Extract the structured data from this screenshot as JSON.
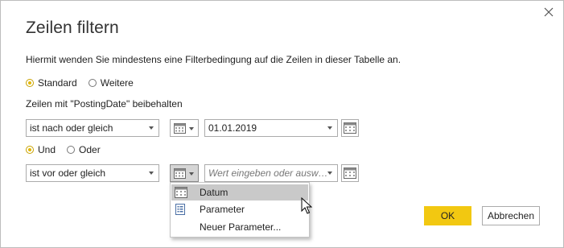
{
  "dialog": {
    "title": "Zeilen filtern",
    "description": "Hiermit wenden Sie mindestens eine Filterbedingung auf die Zeilen in dieser Tabelle an.",
    "mode_options": [
      {
        "label": "Standard",
        "selected": true
      },
      {
        "label": "Weitere",
        "selected": false
      }
    ],
    "keep_label": "Zeilen mit \"PostingDate\" beibehalten"
  },
  "condition1": {
    "operator": "ist nach oder gleich",
    "value": "01.01.2019"
  },
  "logic_options": [
    {
      "label": "Und",
      "selected": true
    },
    {
      "label": "Oder",
      "selected": false
    }
  ],
  "condition2": {
    "operator": "ist vor oder gleich",
    "value_placeholder": "Wert eingeben oder ausw…"
  },
  "type_menu": {
    "items": [
      {
        "label": "Datum",
        "icon": "calendar-icon",
        "highlighted": true
      },
      {
        "label": "Parameter",
        "icon": "parameter-icon",
        "highlighted": false
      },
      {
        "label": "Neuer Parameter...",
        "icon": "",
        "highlighted": false
      }
    ]
  },
  "buttons": {
    "ok": "OK",
    "cancel": "Abbrechen"
  },
  "colors": {
    "accent": "#f2c811",
    "radio_selected": "#e2b700",
    "menu_highlight": "#c9c9c9"
  }
}
